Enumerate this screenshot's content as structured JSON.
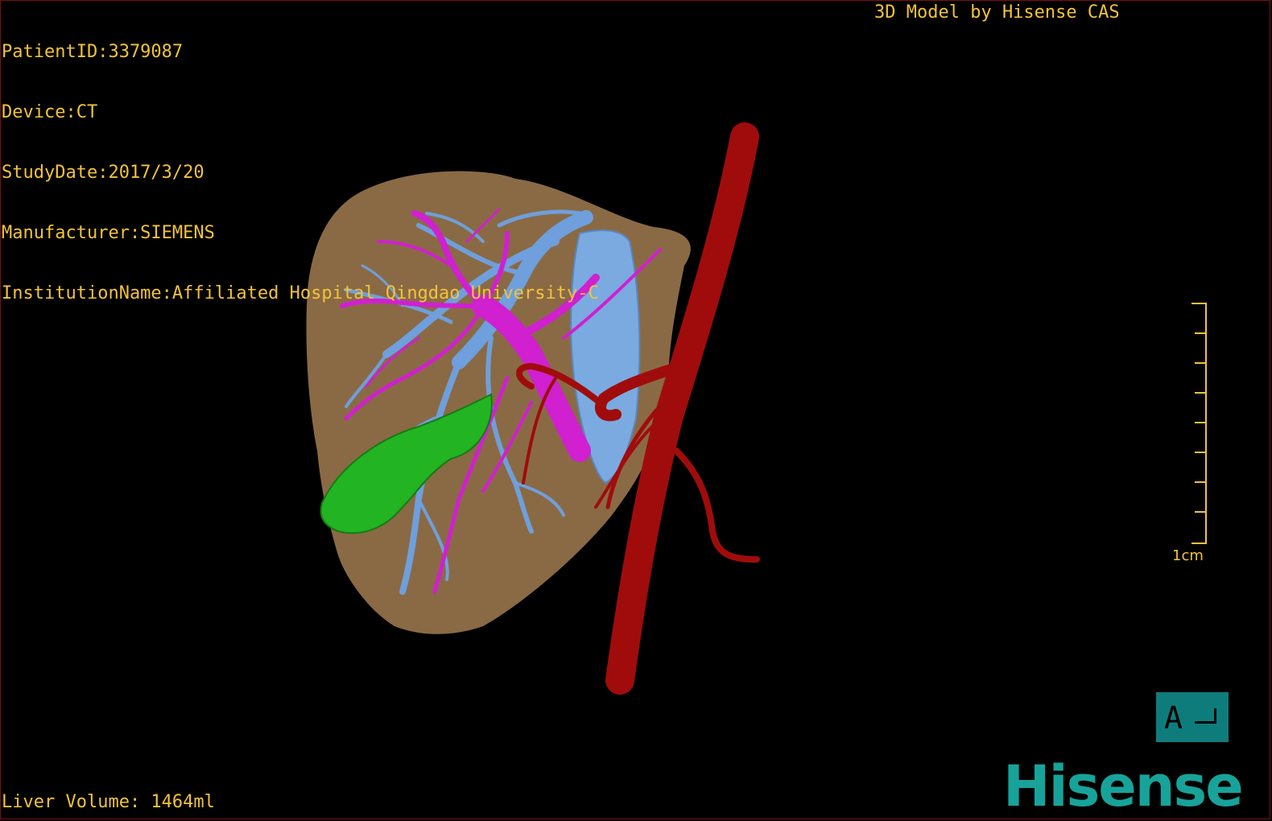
{
  "overlay": {
    "patient_id": "PatientID:3379087",
    "device": "Device:CT",
    "study_date": "StudyDate:2017/3/20",
    "manufacturer": "Manufacturer:SIEMENS",
    "institution": "InstitutionName:Affiliated Hospital Qingdao University-C",
    "model_by": "3D Model by Hisense CAS",
    "liver_volume": "Liver Volume: 1464ml"
  },
  "scale_bar": {
    "label": "1cm",
    "ticks": 9
  },
  "orientation": {
    "letter": "A"
  },
  "logo": {
    "text": "Hisense"
  },
  "colors": {
    "text": "#f2c33a",
    "liver": "#8a6a44",
    "portal_vein": "#d020d0",
    "hepatic_vein": "#6f9fdc",
    "artery_aorta": "#a00c0c",
    "gallbladder": "#20b020",
    "logo": "#17a39a",
    "orientation_box": "#0f7c7c"
  }
}
